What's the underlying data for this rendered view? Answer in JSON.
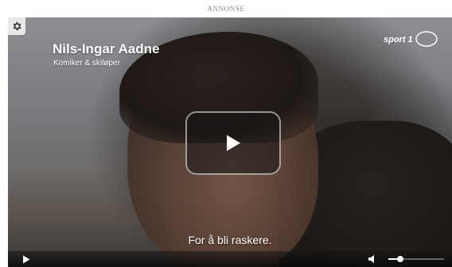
{
  "ad_label": "ANNONSE",
  "video": {
    "title": "Nils-Ingar Aadne",
    "subtitle": "Komiker & skiløper",
    "brand_logo": "sport 1",
    "caption": "For å bli raskere.",
    "icons": {
      "settings": "gear-icon",
      "center_play": "play-icon",
      "control_play": "play-icon",
      "volume": "speaker-icon"
    }
  },
  "controls": {
    "volume_level": 0.22
  },
  "colors": {
    "caption_text": "#ffffff",
    "control_bar": "#141414",
    "settings_bg": "#e8e8e8"
  }
}
